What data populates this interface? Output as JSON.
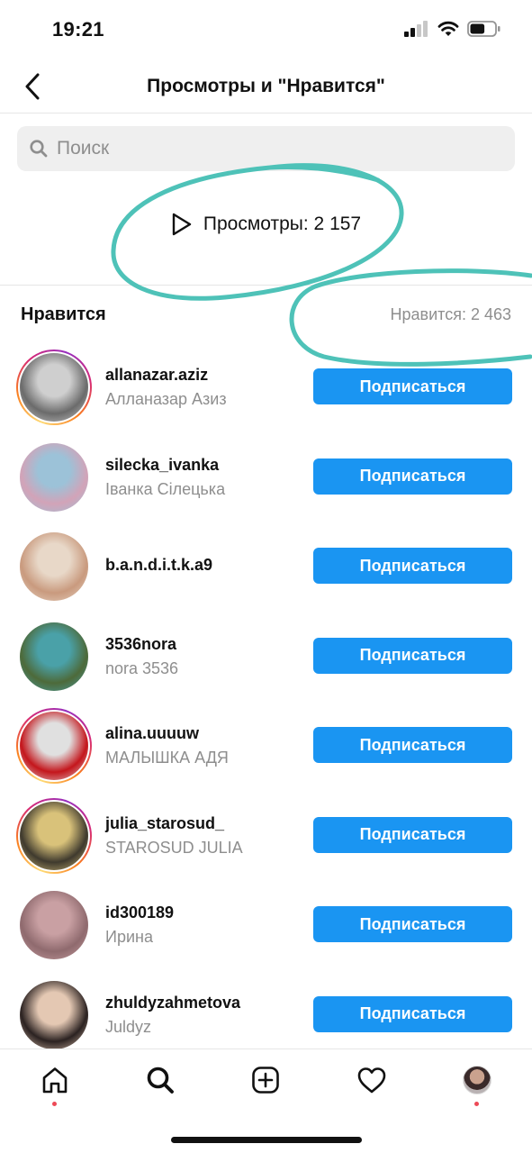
{
  "status_bar": {
    "time": "19:21",
    "battery_level": 0.6
  },
  "header": {
    "title": "Просмотры и \"Нравится\""
  },
  "search": {
    "placeholder": "Поиск",
    "value": ""
  },
  "views": {
    "label": "Просмотры: 2 157"
  },
  "likes": {
    "heading": "Нравится",
    "count_label": "Нравится: 2 463"
  },
  "users": [
    {
      "username": "allanazar.aziz",
      "fullname": "Алланазар Азиз",
      "button": "Подписаться",
      "story": true,
      "avatar_colors": [
        "#cfcfcf",
        "#6b6b6b"
      ]
    },
    {
      "username": "silecka_ivanka",
      "fullname": "Іванка Сілецька",
      "button": "Подписаться",
      "story": false,
      "avatar_colors": [
        "#9cc2d8",
        "#d2a3b8"
      ]
    },
    {
      "username": "b.a.n.d.i.t.k.a9",
      "fullname": "",
      "button": "Подписаться",
      "story": false,
      "avatar_colors": [
        "#e8d8c8",
        "#c99a7e"
      ]
    },
    {
      "username": "3536nora",
      "fullname": "nora 3536",
      "button": "Подписаться",
      "story": false,
      "avatar_colors": [
        "#4aa1a8",
        "#4d6a3a"
      ]
    },
    {
      "username": "alina.uuuuw",
      "fullname": "МАЛЫШКА АДЯ",
      "button": "Подписаться",
      "story": true,
      "avatar_colors": [
        "#e0e0e0",
        "#c4161c"
      ]
    },
    {
      "username": "julia_starosud_",
      "fullname": "STAROSUD JULIA",
      "button": "Подписаться",
      "story": true,
      "avatar_colors": [
        "#d9c27a",
        "#3f3a2e"
      ]
    },
    {
      "username": "id300189",
      "fullname": "Ирина",
      "button": "Подписаться",
      "story": false,
      "avatar_colors": [
        "#c9a0a3",
        "#8f6a6e"
      ]
    },
    {
      "username": "zhuldyzahmetova",
      "fullname": "Juldyz",
      "button": "Подписаться",
      "story": false,
      "avatar_colors": [
        "#e4c8b3",
        "#2b2221"
      ]
    }
  ],
  "tab_bar": {
    "tabs": [
      {
        "name": "home",
        "icon": "home-icon",
        "active": true,
        "dot": true
      },
      {
        "name": "search",
        "icon": "search-icon",
        "active": false,
        "dot": false
      },
      {
        "name": "new-post",
        "icon": "plus-square-icon",
        "active": false,
        "dot": false
      },
      {
        "name": "activity",
        "icon": "heart-icon",
        "active": false,
        "dot": false
      },
      {
        "name": "profile",
        "icon": "profile-avatar-icon",
        "active": false,
        "dot": true
      }
    ]
  },
  "colors": {
    "accent": "#1a95f2",
    "annotation": "#4ec2b8",
    "notification_dot": "#ed4956"
  }
}
